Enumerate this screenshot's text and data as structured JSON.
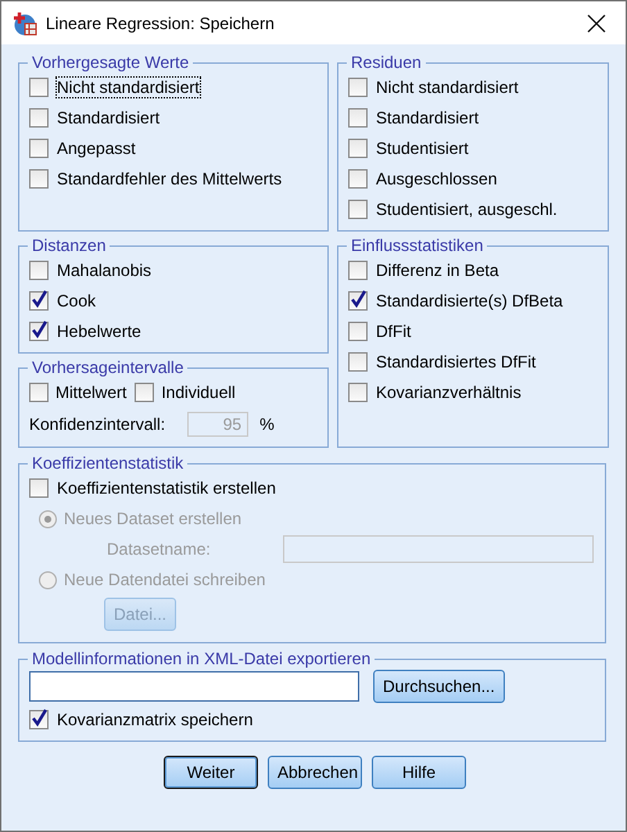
{
  "window": {
    "title": "Lineare Regression: Speichern"
  },
  "predicted": {
    "legend": "Vorhergesagte Werte",
    "items": [
      {
        "label": "Nicht standardisiert",
        "checked": false,
        "focused": true
      },
      {
        "label": "Standardisiert",
        "checked": false,
        "focused": false
      },
      {
        "label": "Angepasst",
        "checked": false,
        "focused": false
      },
      {
        "label": "Standardfehler des Mittelwerts",
        "checked": false,
        "focused": false
      }
    ]
  },
  "residuals": {
    "legend": "Residuen",
    "items": [
      {
        "label": "Nicht standardisiert",
        "checked": false
      },
      {
        "label": "Standardisiert",
        "checked": false
      },
      {
        "label": "Studentisiert",
        "checked": false
      },
      {
        "label": "Ausgeschlossen",
        "checked": false
      },
      {
        "label": "Studentisiert, ausgeschl.",
        "checked": false
      }
    ]
  },
  "distances": {
    "legend": "Distanzen",
    "items": [
      {
        "label": "Mahalanobis",
        "checked": false
      },
      {
        "label": "Cook",
        "checked": true
      },
      {
        "label": "Hebelwerte",
        "checked": true
      }
    ]
  },
  "influence": {
    "legend": "Einflussstatistiken",
    "items": [
      {
        "label": "Differenz in Beta",
        "checked": false
      },
      {
        "label": "Standardisierte(s) DfBeta",
        "checked": true
      },
      {
        "label": "DfFit",
        "checked": false
      },
      {
        "label": "Standardisiertes DfFit",
        "checked": false
      },
      {
        "label": "Kovarianzverhältnis",
        "checked": false
      }
    ]
  },
  "intervals": {
    "legend": "Vorhersageintervalle",
    "items": [
      {
        "label": "Mittelwert",
        "checked": false
      },
      {
        "label": "Individuell",
        "checked": false
      }
    ],
    "confidence": {
      "label": "Konfidenzintervall:",
      "value": "95",
      "unit": "%",
      "disabled": true
    }
  },
  "coefficients": {
    "legend": "Koeffizientenstatistik",
    "checkbox": {
      "label": "Koeffizientenstatistik erstellen",
      "checked": false
    },
    "options": [
      {
        "label": "Neues Dataset erstellen",
        "selected": true,
        "disabled": true
      },
      {
        "label": "Neue Datendatei schreiben",
        "selected": false,
        "disabled": true
      }
    ],
    "dataset_name": {
      "label": "Datasetname:",
      "disabled": true
    },
    "file_button": {
      "label": "Datei...",
      "disabled": true
    }
  },
  "xml_export": {
    "legend": "Modellinformationen in XML-Datei exportieren",
    "browse_button": {
      "label": "Durchsuchen..."
    },
    "checkbox": {
      "label": "Kovarianzmatrix speichern",
      "checked": true
    }
  },
  "buttons": [
    {
      "label": "Weiter",
      "default": true
    },
    {
      "label": "Abbrechen",
      "default": false
    },
    {
      "label": "Hilfe",
      "default": false
    }
  ]
}
